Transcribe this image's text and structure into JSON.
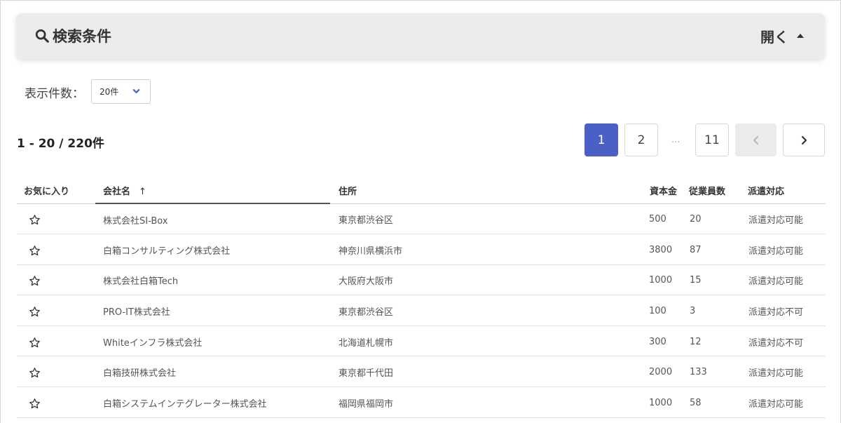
{
  "search": {
    "title": "検索条件",
    "toggle_label": "開く"
  },
  "per_page": {
    "label": "表示件数：",
    "value": "20件"
  },
  "results": {
    "count_text": "1 - 20 / 220件"
  },
  "pagination": {
    "pages": [
      "1",
      "2",
      "11"
    ],
    "ellipsis": "...",
    "current": "1"
  },
  "table": {
    "headers": {
      "favorite": "お気に入り",
      "company": "会社名",
      "sort_arrow": "↑",
      "address": "住所",
      "capital": "資本金",
      "employees": "従業員数",
      "dispatch": "派遣対応"
    },
    "rows": [
      {
        "company": "株式会社SI-Box",
        "address": "東京都渋谷区",
        "capital": "500",
        "employees": "20",
        "dispatch": "派遣対応可能"
      },
      {
        "company": "白箱コンサルティング株式会社",
        "address": "神奈川県横浜市",
        "capital": "3800",
        "employees": "87",
        "dispatch": "派遣対応可能"
      },
      {
        "company": "株式会社白箱Tech",
        "address": "大阪府大阪市",
        "capital": "1000",
        "employees": "15",
        "dispatch": "派遣対応可能"
      },
      {
        "company": "PRO-IT株式会社",
        "address": "東京都渋谷区",
        "capital": "100",
        "employees": "3",
        "dispatch": "派遣対応不可"
      },
      {
        "company": "Whiteインフラ株式会社",
        "address": "北海道札幌市",
        "capital": "300",
        "employees": "12",
        "dispatch": "派遣対応不可"
      },
      {
        "company": "白箱技研株式会社",
        "address": "東京都千代田",
        "capital": "2000",
        "employees": "133",
        "dispatch": "派遣対応可能"
      },
      {
        "company": "白箱システムインテグレーター株式会社",
        "address": "福岡県福岡市",
        "capital": "1000",
        "employees": "58",
        "dispatch": "派遣対応可能"
      }
    ]
  },
  "colors": {
    "accent": "#4a60c6",
    "panel_bg": "#ececec",
    "disabled_bg": "#ebebeb"
  },
  "icons": {
    "search": "search-icon",
    "caret": "caret-up-icon",
    "chevron": "chevron-down-icon",
    "star": "star-outline-icon",
    "prev": "chevron-left-icon",
    "next": "chevron-right-icon"
  }
}
